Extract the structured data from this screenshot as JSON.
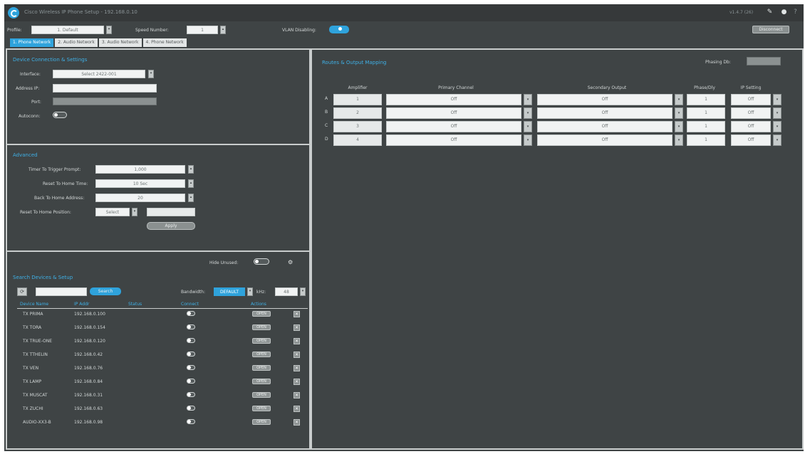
{
  "window": {
    "title": "Cisco Wireless IP Phone Setup - 192.168.0.10",
    "version": "v1.4.7 (26)",
    "icons": [
      "edit-icon",
      "circle-icon",
      "help-icon"
    ]
  },
  "toolbar": {
    "profile_label": "Profile:",
    "profile_value": "1. Default",
    "speed_label": "Speed Number:",
    "speed_value": "1",
    "vlan_label": "VLAN Disabling:",
    "apply_label": "Disconnect"
  },
  "tabs": [
    "1. Phone Network",
    "2. Audio Network",
    "3. Audio Network",
    "4. Phone Network"
  ],
  "device_panel": {
    "title": "Device Connection & Settings",
    "interface_label": "Interface:",
    "interface_value": "Select 2422-001",
    "address_label": "Address IP:",
    "address_value": "",
    "port_label": "Port:",
    "port_value": "",
    "autoconn_label": "Autoconn:"
  },
  "advanced_panel": {
    "title": "Advanced",
    "fields": [
      {
        "label": "Timer To Trigger Prompt:",
        "value": "1,000"
      },
      {
        "label": "Reset To Home Time:",
        "value": "10 Sec"
      },
      {
        "label": "Back To Home Address:",
        "value": "20"
      }
    ],
    "reset_label": "Reset To Home Position:",
    "reset_value": "Select",
    "reset_extra": "",
    "apply_label": "Apply"
  },
  "device_list_panel": {
    "title": "Search Devices & Setup",
    "hide_unused_label": "Hide Unused:",
    "search_value": "",
    "search_button": "Search",
    "bandwidth_label": "Bandwidth:",
    "bandwidth_value": "DEFAULT",
    "rate_label": "kHz:",
    "rate_value": "48",
    "columns": [
      "Device Name",
      "IP Addr",
      "Status",
      "Connect",
      "Actions"
    ],
    "rows": [
      {
        "name": "TX PRIMA",
        "ip": "192.168.0.100",
        "action": "OPEN"
      },
      {
        "name": "TX TORA",
        "ip": "192.168.0.154",
        "action": "OPEN"
      },
      {
        "name": "TX TRUE-ONE",
        "ip": "192.168.0.120",
        "action": "OPEN"
      },
      {
        "name": "TX TTHELIN",
        "ip": "192.168.0.42",
        "action": "OPEN"
      },
      {
        "name": "TX VEN",
        "ip": "192.168.0.76",
        "action": "OPEN"
      },
      {
        "name": "TX LAMP",
        "ip": "192.168.0.84",
        "action": "OPEN"
      },
      {
        "name": "TX MUSCAT",
        "ip": "192.168.0.31",
        "action": "OPEN"
      },
      {
        "name": "TX ZUCHI",
        "ip": "192.168.0.63",
        "action": "OPEN"
      },
      {
        "name": "AUDIO-XX3-B",
        "ip": "192.168.0.98",
        "action": "OPEN"
      }
    ]
  },
  "routing_panel": {
    "title": "Routes & Output Mapping",
    "phasing_label": "Phasing Db:",
    "phasing_value": "",
    "columns": [
      "Amplifier",
      "Primary Channel",
      "Secondary Output",
      "Phase/Dly",
      "IP Setting"
    ],
    "rows": [
      {
        "n": "A",
        "amp": "1",
        "primary": "Off",
        "secondary": "Off",
        "phase": "1",
        "ip": "Off"
      },
      {
        "n": "B",
        "amp": "2",
        "primary": "Off",
        "secondary": "Off",
        "phase": "1",
        "ip": "Off"
      },
      {
        "n": "C",
        "amp": "3",
        "primary": "Off",
        "secondary": "Off",
        "phase": "1",
        "ip": "Off"
      },
      {
        "n": "D",
        "amp": "4",
        "primary": "Off",
        "secondary": "Off",
        "phase": "1",
        "ip": "Off"
      }
    ]
  },
  "colors": {
    "accent": "#2fa3dc",
    "background": "#3f4445",
    "panel_border": "#c9cdcd"
  }
}
